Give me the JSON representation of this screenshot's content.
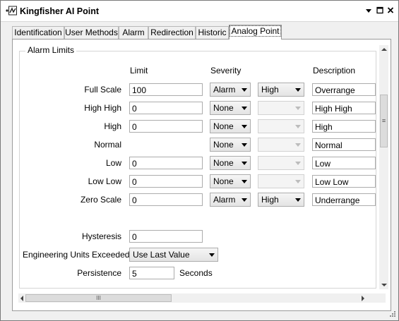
{
  "window": {
    "title": "Kingfisher AI Point"
  },
  "tabs": [
    "Identification",
    "User Methods",
    "Alarm",
    "Redirection",
    "Historic",
    "Analog Point"
  ],
  "group": {
    "title": "Alarm Limits"
  },
  "columns": {
    "limit": "Limit",
    "severity": "Severity",
    "description": "Description"
  },
  "rows": [
    {
      "label": "Full Scale",
      "limit": "100",
      "severity": "Alarm",
      "level": "High",
      "description": "Overrange"
    },
    {
      "label": "High High",
      "limit": "0",
      "severity": "None",
      "level": "",
      "description": "High High"
    },
    {
      "label": "High",
      "limit": "0",
      "severity": "None",
      "level": "",
      "description": "High"
    },
    {
      "label": "Normal",
      "limit": "",
      "severity": "None",
      "level": "",
      "description": "Normal"
    },
    {
      "label": "Low",
      "limit": "0",
      "severity": "None",
      "level": "",
      "description": "Low"
    },
    {
      "label": "Low Low",
      "limit": "0",
      "severity": "None",
      "level": "",
      "description": "Low Low"
    },
    {
      "label": "Zero Scale",
      "limit": "0",
      "severity": "Alarm",
      "level": "High",
      "description": "Underrange"
    }
  ],
  "hysteresis": {
    "label": "Hysteresis",
    "value": "0"
  },
  "eu_exceeded": {
    "label": "Engineering Units Exceeded",
    "value": "Use Last Value"
  },
  "persistence": {
    "label": "Persistence",
    "value": "5",
    "unit": "Seconds"
  },
  "scroll": {
    "h_thumb_grip": "III",
    "v_thumb_grip": "≡"
  }
}
